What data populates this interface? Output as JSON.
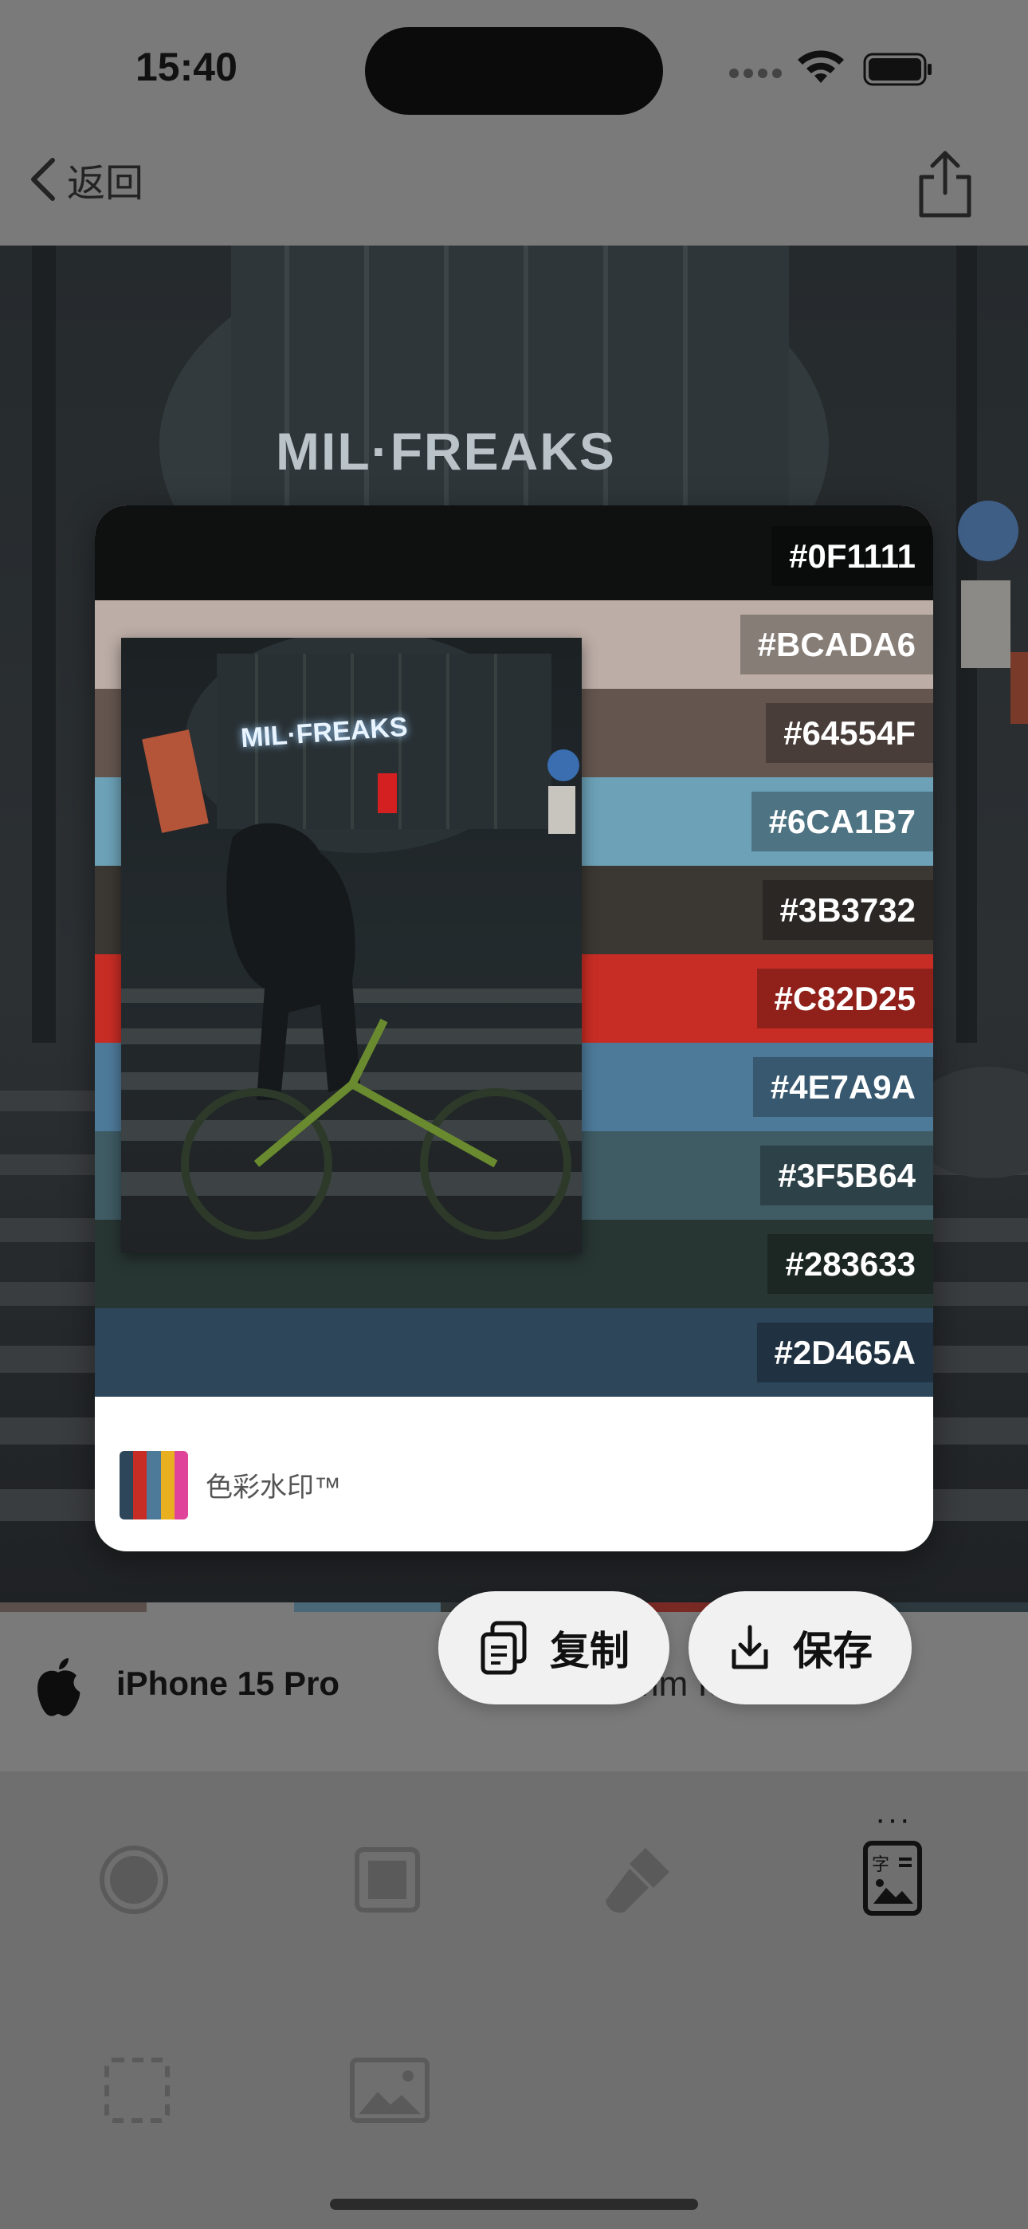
{
  "status_bar": {
    "time": "15:40"
  },
  "nav": {
    "back_label": "返回",
    "share_icon": "share-icon"
  },
  "photo": {
    "sign_text": "MIL·FREAKS"
  },
  "palette": [
    {
      "hex": "#0F1111",
      "color": "#0F1111"
    },
    {
      "hex": "#BCADA6",
      "color": "#BCADA6"
    },
    {
      "hex": "#64554F",
      "color": "#64554F"
    },
    {
      "hex": "#6CA1B7",
      "color": "#6CA1B7"
    },
    {
      "hex": "#3B3732",
      "color": "#3B3732"
    },
    {
      "hex": "#C82D25",
      "color": "#C82D25"
    },
    {
      "hex": "#4E7A9A",
      "color": "#4E7A9A"
    },
    {
      "hex": "#3F5B64",
      "color": "#3F5B64"
    },
    {
      "hex": "#283633",
      "color": "#283633"
    },
    {
      "hex": "#2D465A",
      "color": "#2D465A"
    }
  ],
  "card": {
    "brand_text": "色彩水印™",
    "brand_colors": [
      "#2D465A",
      "#C82D25",
      "#4E7A9A",
      "#E8B020",
      "#E0449A"
    ]
  },
  "actions": {
    "copy_label": "复制",
    "save_label": "保存"
  },
  "exif": {
    "device": "iPhone 15 Pro",
    "params": "mm  ISO320"
  },
  "toolbar": {
    "more": "···"
  }
}
